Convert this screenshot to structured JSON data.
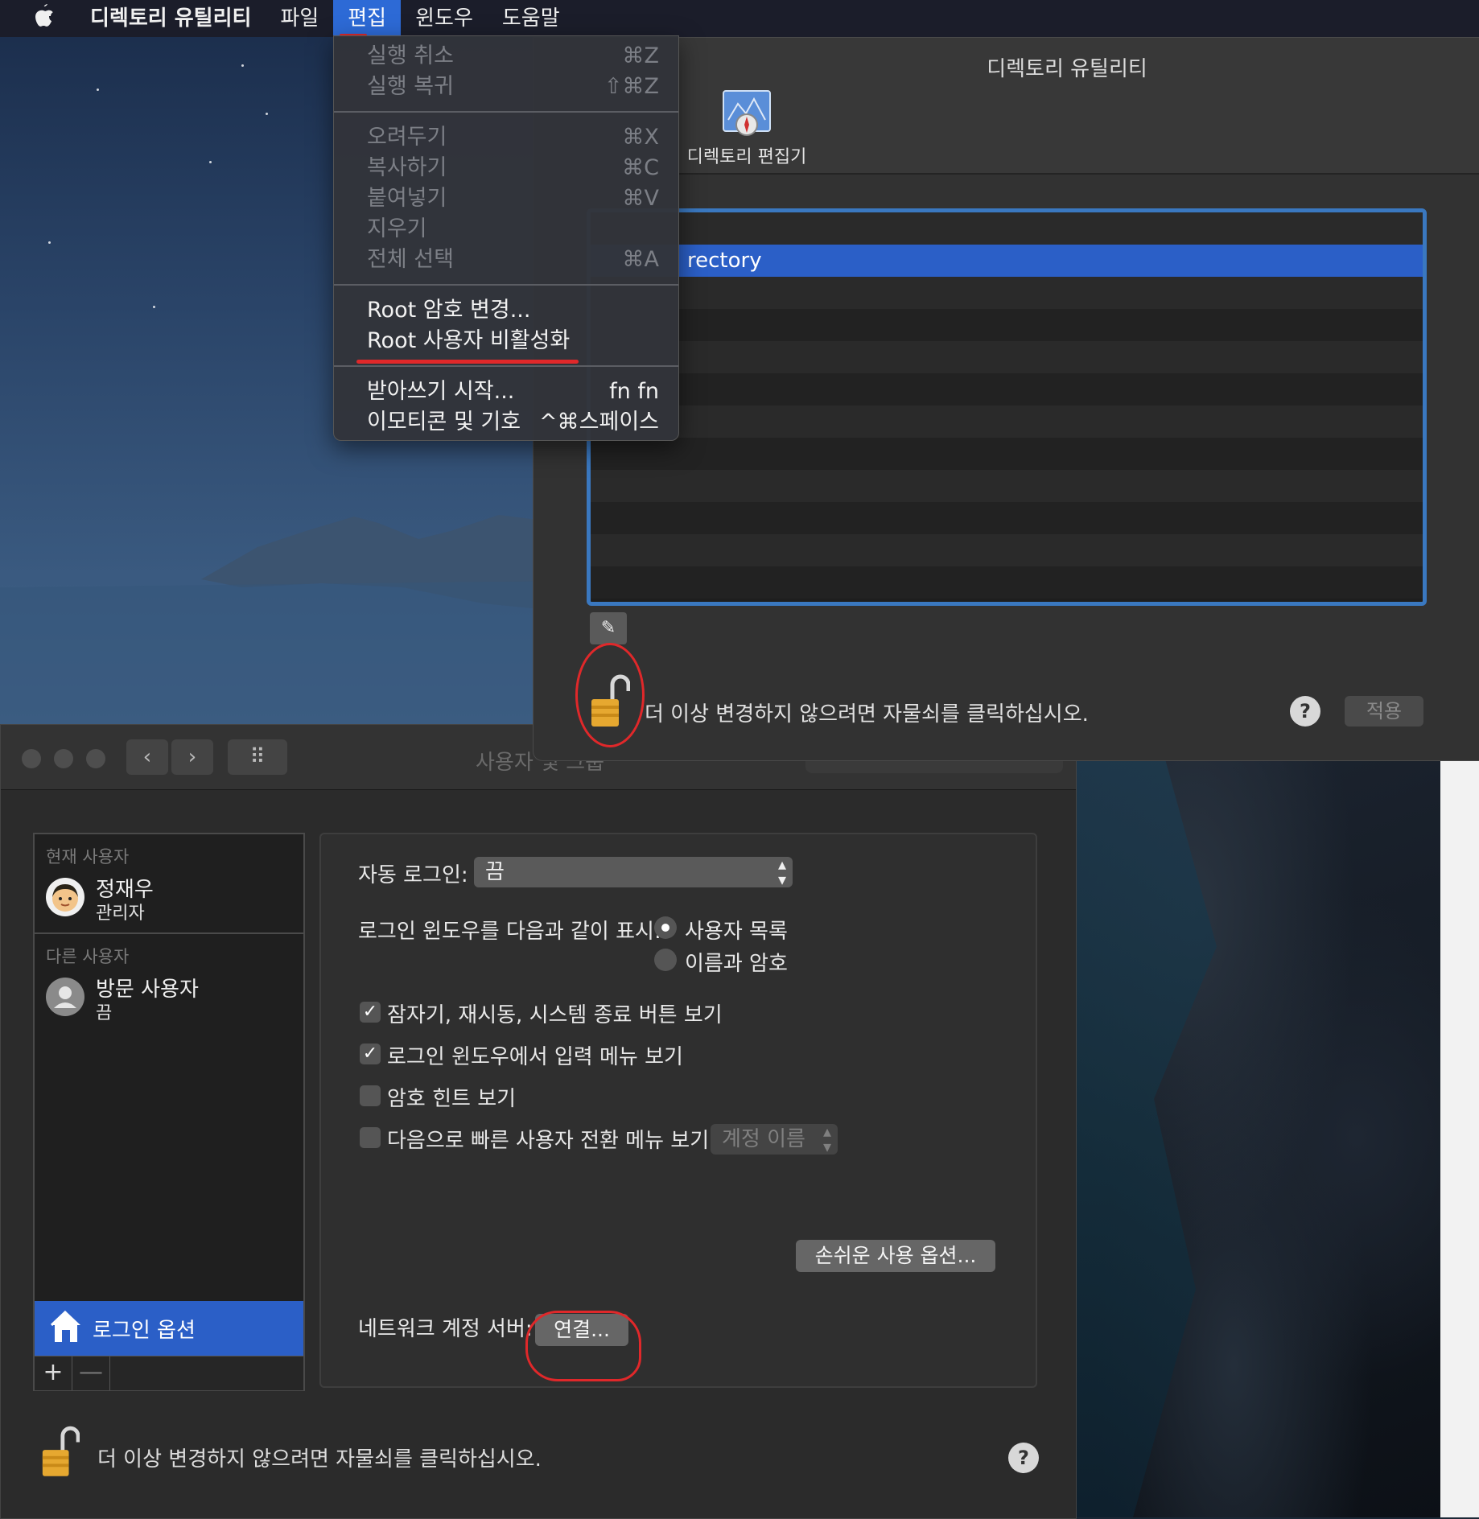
{
  "menubar": {
    "apple": "",
    "app_name": "디렉토리 유틸리티",
    "items": [
      "파일",
      "편집",
      "윈도우",
      "도움말"
    ]
  },
  "edit_menu": {
    "group1": [
      {
        "label": "실행 취소",
        "shortcut": "⌘Z"
      },
      {
        "label": "실행 복귀",
        "shortcut": "⇧⌘Z"
      }
    ],
    "group2": [
      {
        "label": "오려두기",
        "shortcut": "⌘X"
      },
      {
        "label": "복사하기",
        "shortcut": "⌘C"
      },
      {
        "label": "붙여넣기",
        "shortcut": "⌘V"
      },
      {
        "label": "지우기",
        "shortcut": ""
      },
      {
        "label": "전체 선택",
        "shortcut": "⌘A"
      }
    ],
    "group3": [
      {
        "label": "Root 암호 변경...",
        "shortcut": ""
      },
      {
        "label": "Root 사용자 비활성화",
        "shortcut": ""
      }
    ],
    "group4": [
      {
        "label": "받아쓰기 시작...",
        "shortcut": "fn fn"
      },
      {
        "label": "이모티콘 및 기호",
        "shortcut": "^⌘스페이스"
      }
    ]
  },
  "directory_utility": {
    "title": "디렉토리 유틸리티",
    "toolbar_item": "디렉토리 편집기",
    "list_selected": "rectory",
    "lock_text": "더 이상 변경하지 않으려면 자물쇠를 클릭하십시오.",
    "help": "?",
    "apply": "적용",
    "pencil": "✎"
  },
  "users_prefs": {
    "title": "사용자 및 그룹",
    "nav_back": "‹",
    "nav_forward": "›",
    "grid": "⠿",
    "current_section": "현재 사용자",
    "current_user": {
      "name": "정재우",
      "role": "관리자"
    },
    "other_section": "다른 사용자",
    "guest_user": {
      "name": "방문 사용자",
      "status": "끔"
    },
    "login_options": "로그인 옵션",
    "add": "+",
    "remove": "—",
    "auto_login_label": "자동 로그인:",
    "auto_login_value": "끔",
    "display_label": "로그인 윈도우를 다음과 같이 표시:",
    "display_options": [
      "사용자 목록",
      "이름과 암호"
    ],
    "checks": [
      {
        "label": "잠자기, 재시동, 시스템 종료 버튼 보기",
        "checked": true
      },
      {
        "label": "로그인 윈도우에서 입력 메뉴 보기",
        "checked": true
      },
      {
        "label": "암호 힌트 보기",
        "checked": false
      },
      {
        "label": "다음으로 빠른 사용자 전환 메뉴 보기:",
        "checked": false
      }
    ],
    "fast_switch_value": "계정 이름",
    "accessibility_button": "손쉬운 사용 옵션...",
    "network_label": "네트워크 계정 서버:",
    "connect_button": "연결...",
    "lock_text": "더 이상 변경하지 않으려면 자물쇠를 클릭하십시오.",
    "help": "?"
  },
  "colors": {
    "accent": "#2b5fc7",
    "annotation_red": "#e0282a",
    "lock_gold": "#e6a830"
  }
}
